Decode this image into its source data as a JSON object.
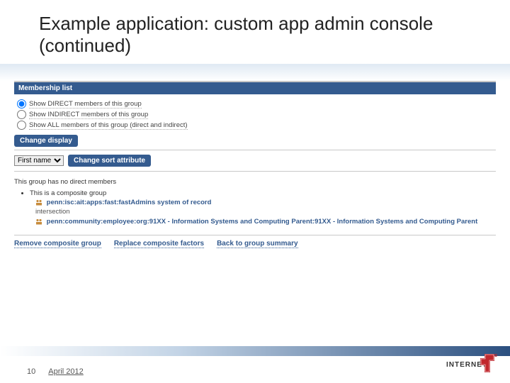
{
  "title": "Example application: custom app admin console (continued)",
  "section_heading": "Membership list",
  "radios": {
    "direct": "Show DIRECT members of this group",
    "indirect": "Show INDIRECT members of this group",
    "all": "Show ALL members of this group (direct and indirect)"
  },
  "buttons": {
    "change_display": "Change display",
    "change_sort": "Change sort attribute"
  },
  "sort_select": {
    "value": "First name"
  },
  "info": {
    "no_members": "This group has no direct members",
    "composite_bullet": "This is a composite group",
    "member_paths": [
      "penn:isc:ait:apps:fast:fastAdmins system of record",
      "penn:community:employee:org:91XX - Information Systems and Computing Parent:91XX - Information Systems and Computing Parent"
    ],
    "intersection_label": "intersection"
  },
  "footer_links": {
    "remove": "Remove composite group",
    "replace": "Replace composite factors",
    "back": "Back to group summary"
  },
  "page_number": "10",
  "date": "April 2012",
  "logo_text": "INTERNET"
}
